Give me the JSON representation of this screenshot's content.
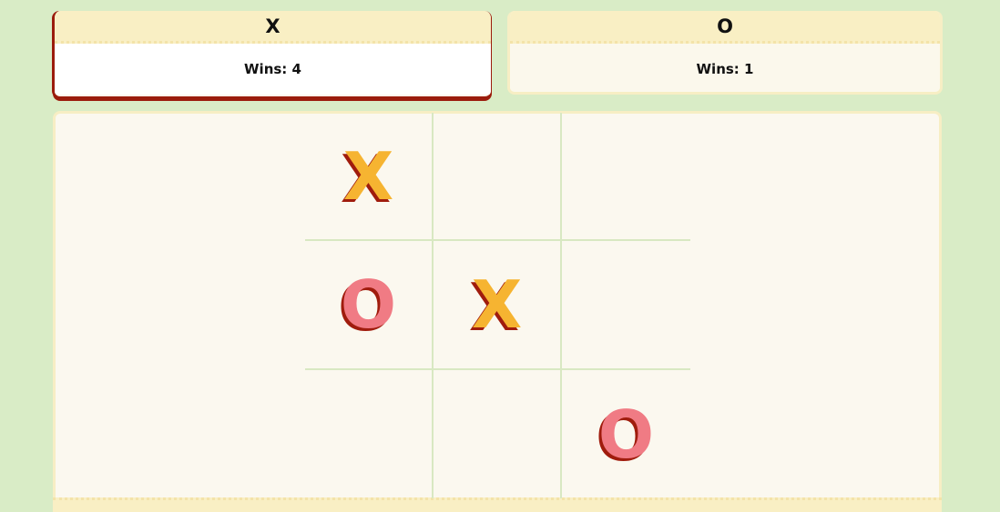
{
  "players": [
    {
      "symbol": "X",
      "wins_label": "Wins: 4",
      "active": true
    },
    {
      "symbol": "O",
      "wins_label": "Wins: 1",
      "active": false
    }
  ],
  "board": {
    "cells": [
      "X",
      "",
      "",
      "O",
      "X",
      "",
      "",
      "",
      "O"
    ]
  },
  "colors": {
    "background": "#d9ecc6",
    "x_mark": "#f6b431",
    "o_mark": "#f07b84",
    "mark_shadow": "#a01c0d",
    "active_border": "#9b1c0c"
  }
}
